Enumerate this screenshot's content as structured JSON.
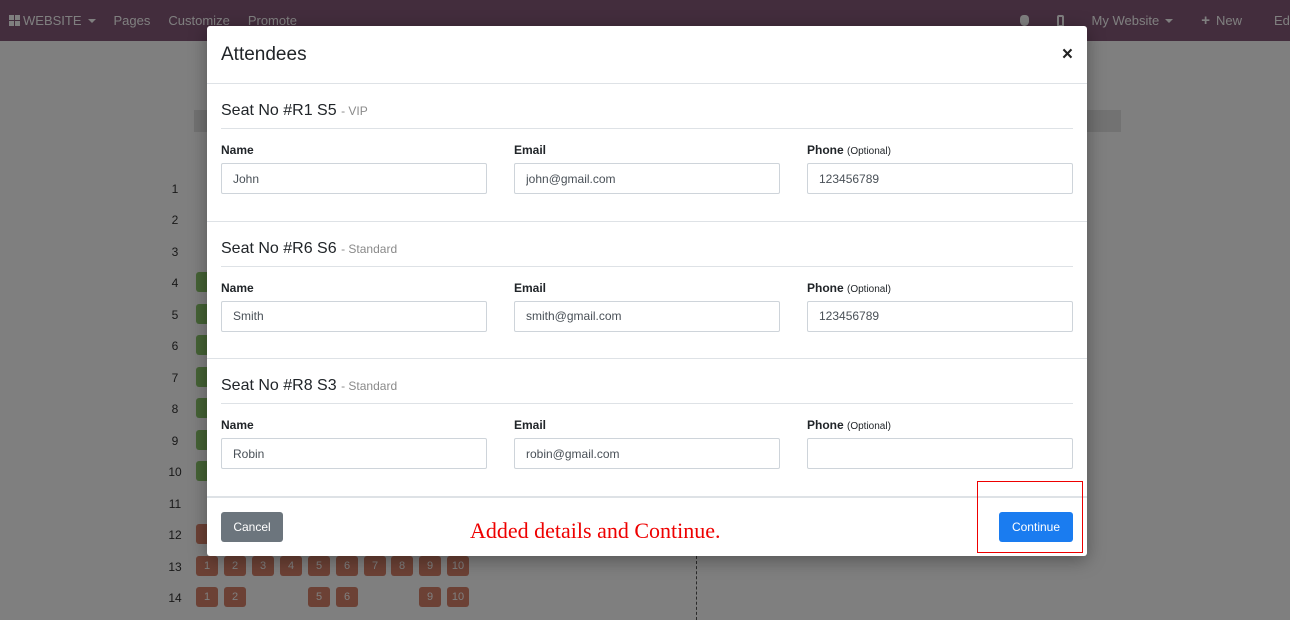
{
  "navbar": {
    "website_label": "WEBSITE",
    "pages_label": "Pages",
    "customize_label": "Customize",
    "promote_label": "Promote",
    "my_website_label": "My Website",
    "new_label": "New",
    "edit_label": "Edi"
  },
  "background": {
    "row_numbers": [
      "1",
      "2",
      "3",
      "4",
      "5",
      "6",
      "7",
      "8",
      "9",
      "10",
      "11",
      "12",
      "13",
      "14"
    ],
    "row13_seats": [
      "1",
      "2",
      "3",
      "4",
      "5",
      "6",
      "7",
      "8",
      "9",
      "10"
    ],
    "row14_seats": [
      "1",
      "2",
      "5",
      "6",
      "9",
      "10"
    ]
  },
  "modal": {
    "title": "Attendees",
    "close_symbol": "×",
    "attendees": [
      {
        "seat_label": "Seat No #R1 S5",
        "seat_type": "- VIP",
        "name_label": "Name",
        "name_value": "John",
        "email_label": "Email",
        "email_value": "john@gmail.com",
        "phone_label": "Phone",
        "phone_optional": "(Optional)",
        "phone_value": "123456789"
      },
      {
        "seat_label": "Seat No #R6 S6",
        "seat_type": "- Standard",
        "name_label": "Name",
        "name_value": "Smith",
        "email_label": "Email",
        "email_value": "smith@gmail.com",
        "phone_label": "Phone",
        "phone_optional": "(Optional)",
        "phone_value": "123456789"
      },
      {
        "seat_label": "Seat No #R8 S3",
        "seat_type": "- Standard",
        "name_label": "Name",
        "name_value": "Robin",
        "email_label": "Email",
        "email_value": "robin@gmail.com",
        "phone_label": "Phone",
        "phone_optional": "(Optional)",
        "phone_value": ""
      }
    ],
    "cancel_label": "Cancel",
    "continue_label": "Continue"
  },
  "annotation": {
    "text": "Added details and Continue.",
    "color": "#e00000"
  },
  "colors": {
    "navbar": "#875a7b",
    "continue_button": "#1a7cf0",
    "cancel_button": "#6c757d",
    "seat_available": "#8bc46b",
    "seat_booked": "#d9826a"
  }
}
